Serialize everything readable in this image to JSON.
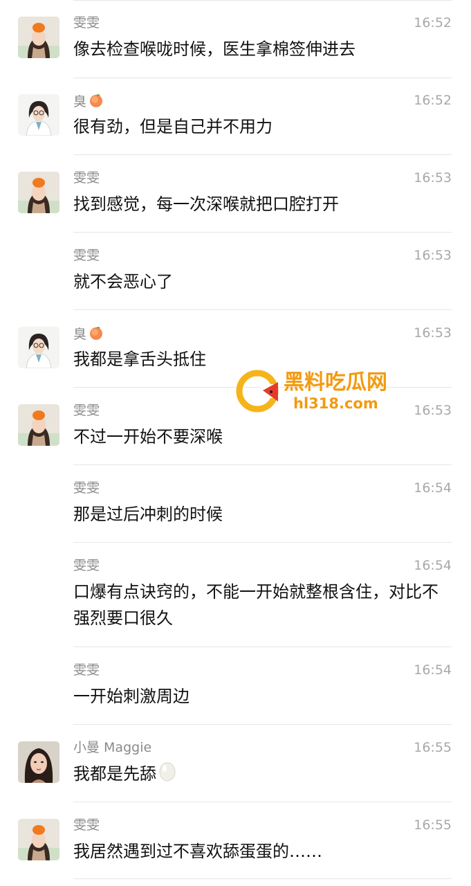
{
  "messages": [
    {
      "sender": "雯雯",
      "time": "16:52",
      "text": "像去检查喉咙时候，医生拿棉签伸进去",
      "avatar": "girl-orange-hat"
    },
    {
      "sender": "臭",
      "sender_emoji": "peach",
      "time": "16:52",
      "text": "很有劲，但是自己并不用力",
      "avatar": "doctor-glasses"
    },
    {
      "sender": "雯雯",
      "time": "16:53",
      "text": "找到感觉，每一次深喉就把口腔打开",
      "avatar": "girl-orange-hat"
    },
    {
      "sender": "雯雯",
      "time": "16:53",
      "text": "就不会恶心了",
      "avatar": ""
    },
    {
      "sender": "臭",
      "sender_emoji": "peach",
      "time": "16:53",
      "text": "我都是拿舌头抵住",
      "avatar": "doctor-glasses"
    },
    {
      "sender": "雯雯",
      "time": "16:53",
      "text": "不过一开始不要深喉",
      "avatar": "girl-orange-hat"
    },
    {
      "sender": "雯雯",
      "time": "16:54",
      "text": "那是过后冲刺的时候",
      "avatar": ""
    },
    {
      "sender": "雯雯",
      "time": "16:54",
      "text": "口爆有点诀窍的，不能一开始就整根含住，对比不强烈要口很久",
      "avatar": ""
    },
    {
      "sender": "雯雯",
      "time": "16:54",
      "text": "一开始刺激周边",
      "avatar": ""
    },
    {
      "sender": "小曼 Maggie",
      "time": "16:55",
      "text": "我都是先舔",
      "text_emoji": "egg",
      "avatar": "woman-photo"
    },
    {
      "sender": "雯雯",
      "time": "16:55",
      "text": "我居然遇到过不喜欢舔蛋蛋的……",
      "avatar": "girl-orange-hat"
    }
  ],
  "watermark": {
    "line1": "黑料吃瓜网",
    "line2": "hl318.com"
  },
  "colors": {
    "name": "#8a8a8a",
    "time": "#a8a8a8",
    "text": "#111111",
    "separator": "#e6e6e6",
    "watermark": "#f39a10"
  }
}
